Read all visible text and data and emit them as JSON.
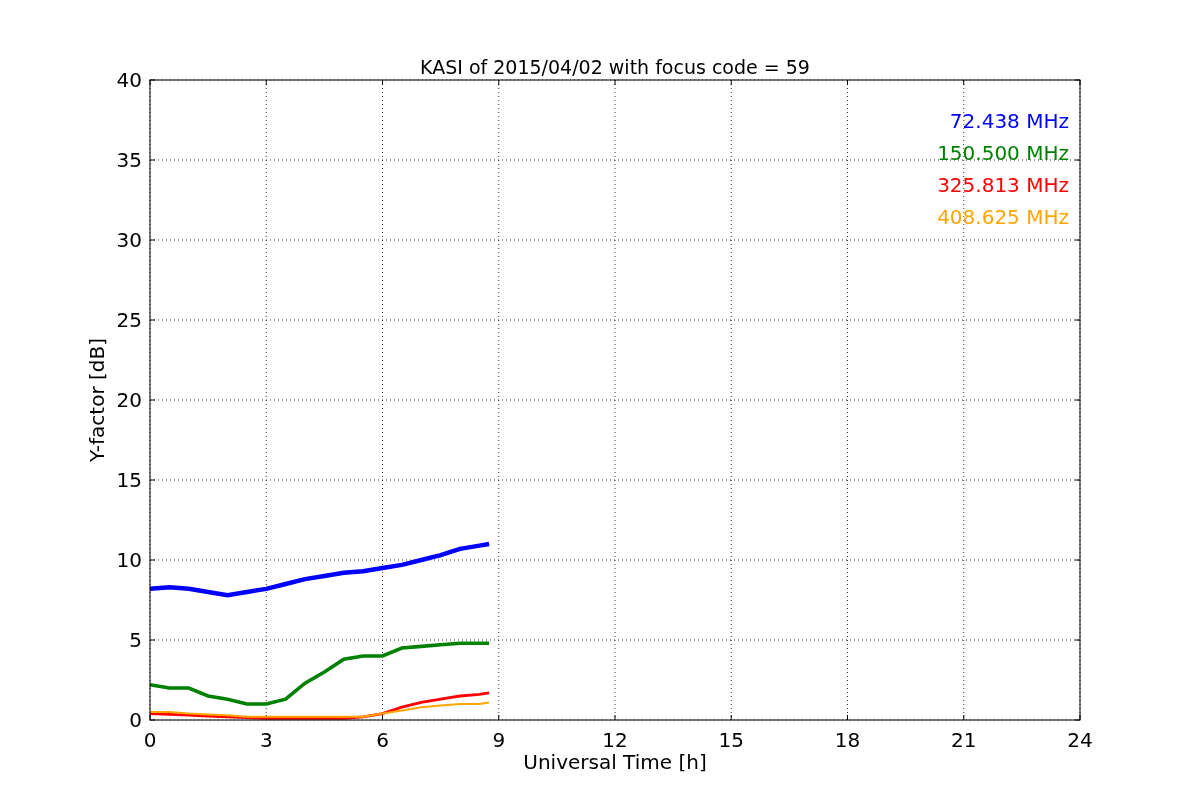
{
  "figure": {
    "chart_data": {
      "type": "line",
      "title": "KASI of 2015/04/02 with focus code = 59",
      "xlabel": "Universal Time [h]",
      "ylabel": "Y-factor [dB]",
      "x": [
        0,
        0.5,
        1,
        1.5,
        2,
        2.5,
        3,
        3.5,
        4,
        4.5,
        5,
        5.5,
        6,
        6.5,
        7,
        7.5,
        8,
        8.5,
        8.75
      ],
      "series": [
        {
          "name": "72.438 MHz",
          "color": "#0000ff",
          "values": [
            8.2,
            8.3,
            8.2,
            8.0,
            7.8,
            8.0,
            8.2,
            8.5,
            8.8,
            9.0,
            9.2,
            9.3,
            9.5,
            9.7,
            10.0,
            10.3,
            10.7,
            10.9,
            11.0
          ]
        },
        {
          "name": "150.500 MHz",
          "color": "#008000",
          "values": [
            2.2,
            2.0,
            2.0,
            1.5,
            1.3,
            1.0,
            1.0,
            1.3,
            2.3,
            3.0,
            3.8,
            4.0,
            4.0,
            4.5,
            4.6,
            4.7,
            4.8,
            4.8,
            4.8
          ]
        },
        {
          "name": "325.813 MHz",
          "color": "#ff0000",
          "values": [
            0.4,
            0.35,
            0.3,
            0.25,
            0.2,
            0.15,
            0.1,
            0.1,
            0.1,
            0.1,
            0.1,
            0.2,
            0.4,
            0.8,
            1.1,
            1.3,
            1.5,
            1.6,
            1.7
          ]
        },
        {
          "name": "408.625 MHz",
          "color": "#ffa500",
          "values": [
            0.5,
            0.5,
            0.4,
            0.35,
            0.3,
            0.2,
            0.2,
            0.2,
            0.2,
            0.2,
            0.2,
            0.2,
            0.4,
            0.6,
            0.8,
            0.9,
            1.0,
            1.0,
            1.1
          ]
        }
      ],
      "grid": true,
      "xlim": [
        0,
        24
      ],
      "ylim": [
        0,
        40
      ],
      "xticks": [
        0,
        3,
        6,
        9,
        12,
        15,
        18,
        21,
        24
      ],
      "yticks": [
        0,
        5,
        10,
        15,
        20,
        25,
        30,
        35,
        40
      ]
    }
  }
}
